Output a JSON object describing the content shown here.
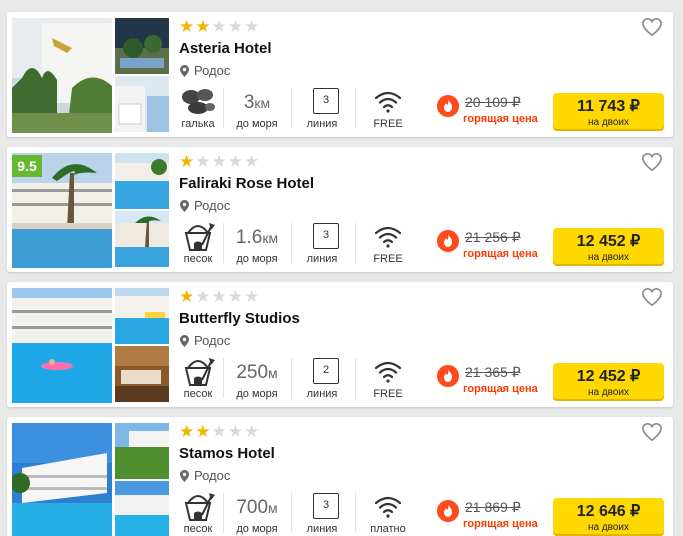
{
  "hotels": [
    {
      "name": "Asteria Hotel",
      "stars": 2,
      "location": "Родос",
      "beach_label": "галька",
      "beach_icon": "pebbles-icon",
      "distance_value": "3",
      "distance_unit": "км",
      "distance_label": "до моря",
      "line_value": "3",
      "line_label": "линия",
      "wifi_label": "FREE",
      "old_price": "20 109 ₽",
      "hot_label": "горящая цена",
      "price": "11 743 ₽",
      "price_sub": "на двоих",
      "rating": ""
    },
    {
      "name": "Faliraki Rose Hotel",
      "stars": 1,
      "location": "Родос",
      "beach_label": "песок",
      "beach_icon": "sand-bucket-icon",
      "distance_value": "1.6",
      "distance_unit": "км",
      "distance_label": "до моря",
      "line_value": "3",
      "line_label": "линия",
      "wifi_label": "FREE",
      "old_price": "21 256 ₽",
      "hot_label": "горящая цена",
      "price": "12 452 ₽",
      "price_sub": "на двоих",
      "rating": "9.5"
    },
    {
      "name": "Butterfly Studios",
      "stars": 1,
      "location": "Родос",
      "beach_label": "песок",
      "beach_icon": "sand-bucket-icon",
      "distance_value": "250",
      "distance_unit": "м",
      "distance_label": "до моря",
      "line_value": "2",
      "line_label": "линия",
      "wifi_label": "FREE",
      "old_price": "21 365 ₽",
      "hot_label": "горящая цена",
      "price": "12 452 ₽",
      "price_sub": "на двоих",
      "rating": ""
    },
    {
      "name": "Stamos Hotel",
      "stars": 2,
      "location": "Родос",
      "beach_label": "песок",
      "beach_icon": "sand-bucket-icon",
      "distance_value": "700",
      "distance_unit": "м",
      "distance_label": "до моря",
      "line_value": "3",
      "line_label": "линия",
      "wifi_label": "платно",
      "old_price": "21 869 ₽",
      "hot_label": "горящая цена",
      "price": "12 646 ₽",
      "price_sub": "на двоих",
      "rating": ""
    }
  ],
  "colors": {
    "accent_yellow": "#ffd800",
    "hot_red": "#ff3a00",
    "star": "#f5b400",
    "rating_green": "#66b831"
  }
}
